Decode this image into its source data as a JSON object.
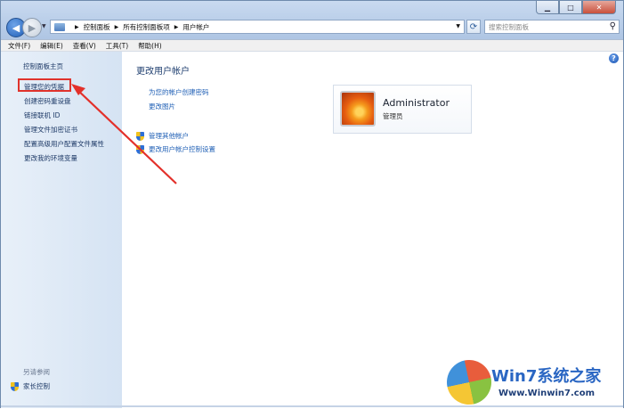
{
  "window": {
    "caption_buttons": {
      "minimize": "▁",
      "maximize": "□",
      "close": "✕"
    }
  },
  "navigation": {
    "breadcrumb": [
      "控制面板",
      "所有控制面板项",
      "用户帐户"
    ],
    "search_placeholder": "搜索控制面板"
  },
  "menu": [
    "文件(F)",
    "编辑(E)",
    "查看(V)",
    "工具(T)",
    "帮助(H)"
  ],
  "sidebar": {
    "home": "控制面板主页",
    "tasks": [
      "管理您的凭据",
      "创建密码重设盘",
      "链接联机 ID",
      "管理文件加密证书",
      "配置高级用户配置文件属性",
      "更改我的环境变量"
    ],
    "see_also_label": "另请参阅",
    "parental_controls": "家长控制"
  },
  "main": {
    "title": "更改用户帐户",
    "links": [
      "为您的帐户创建密码",
      "更改图片"
    ],
    "shield_links": [
      "管理其他帐户",
      "更改用户帐户控制设置"
    ],
    "help": "?"
  },
  "account": {
    "name": "Administrator",
    "role": "管理员"
  },
  "watermark": {
    "title": "Win7系统之家",
    "url": "Www.Winwin7.com"
  },
  "colors": {
    "highlight_box": "#e0332c",
    "link": "#1f5fb5"
  }
}
